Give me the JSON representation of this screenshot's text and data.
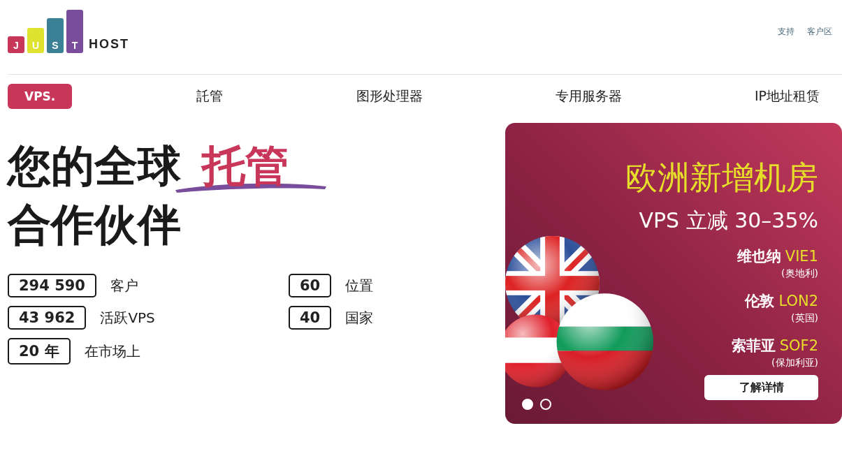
{
  "logo": {
    "letters": [
      {
        "char": "J",
        "color": "#c8375a"
      },
      {
        "char": "U",
        "color": "#dfe22e"
      },
      {
        "char": "S",
        "color": "#3a8196"
      },
      {
        "char": "T",
        "color": "#7a4c9c"
      }
    ],
    "word": "HOST"
  },
  "top_links": [
    "支持",
    "客户区"
  ],
  "nav": [
    {
      "label": "VPS.",
      "selected": true
    },
    {
      "label": "託管",
      "selected": false
    },
    {
      "label": "图形处理器",
      "selected": false
    },
    {
      "label": "专用服务器",
      "selected": false
    },
    {
      "label": "IP地址租赁",
      "selected": false
    }
  ],
  "hero": {
    "title_start": "您的全球",
    "title_highlight": "托管",
    "title_end": "合作伙伴"
  },
  "stats": [
    {
      "value": "294 590",
      "label": "客户"
    },
    {
      "value": "60",
      "label": "位置"
    },
    {
      "value": "43 962",
      "label": "活跃VPS"
    },
    {
      "value": "40",
      "label": "国家"
    },
    {
      "value": "20 年",
      "label": "在市场上"
    }
  ],
  "banner": {
    "headline": "欧洲新增机房",
    "offer": "VPS 立减 30–35%",
    "locations": [
      {
        "city": "维也纳",
        "code": "VIE1",
        "country": "(奥地利)"
      },
      {
        "city": "伦敦",
        "code": "LON2",
        "country": "(英国)"
      },
      {
        "city": "索菲亚",
        "code": "SOF2",
        "country": "(保加利亚)"
      }
    ],
    "button": "了解详情",
    "dots": [
      {
        "selected": true
      },
      {
        "selected": false
      }
    ]
  }
}
